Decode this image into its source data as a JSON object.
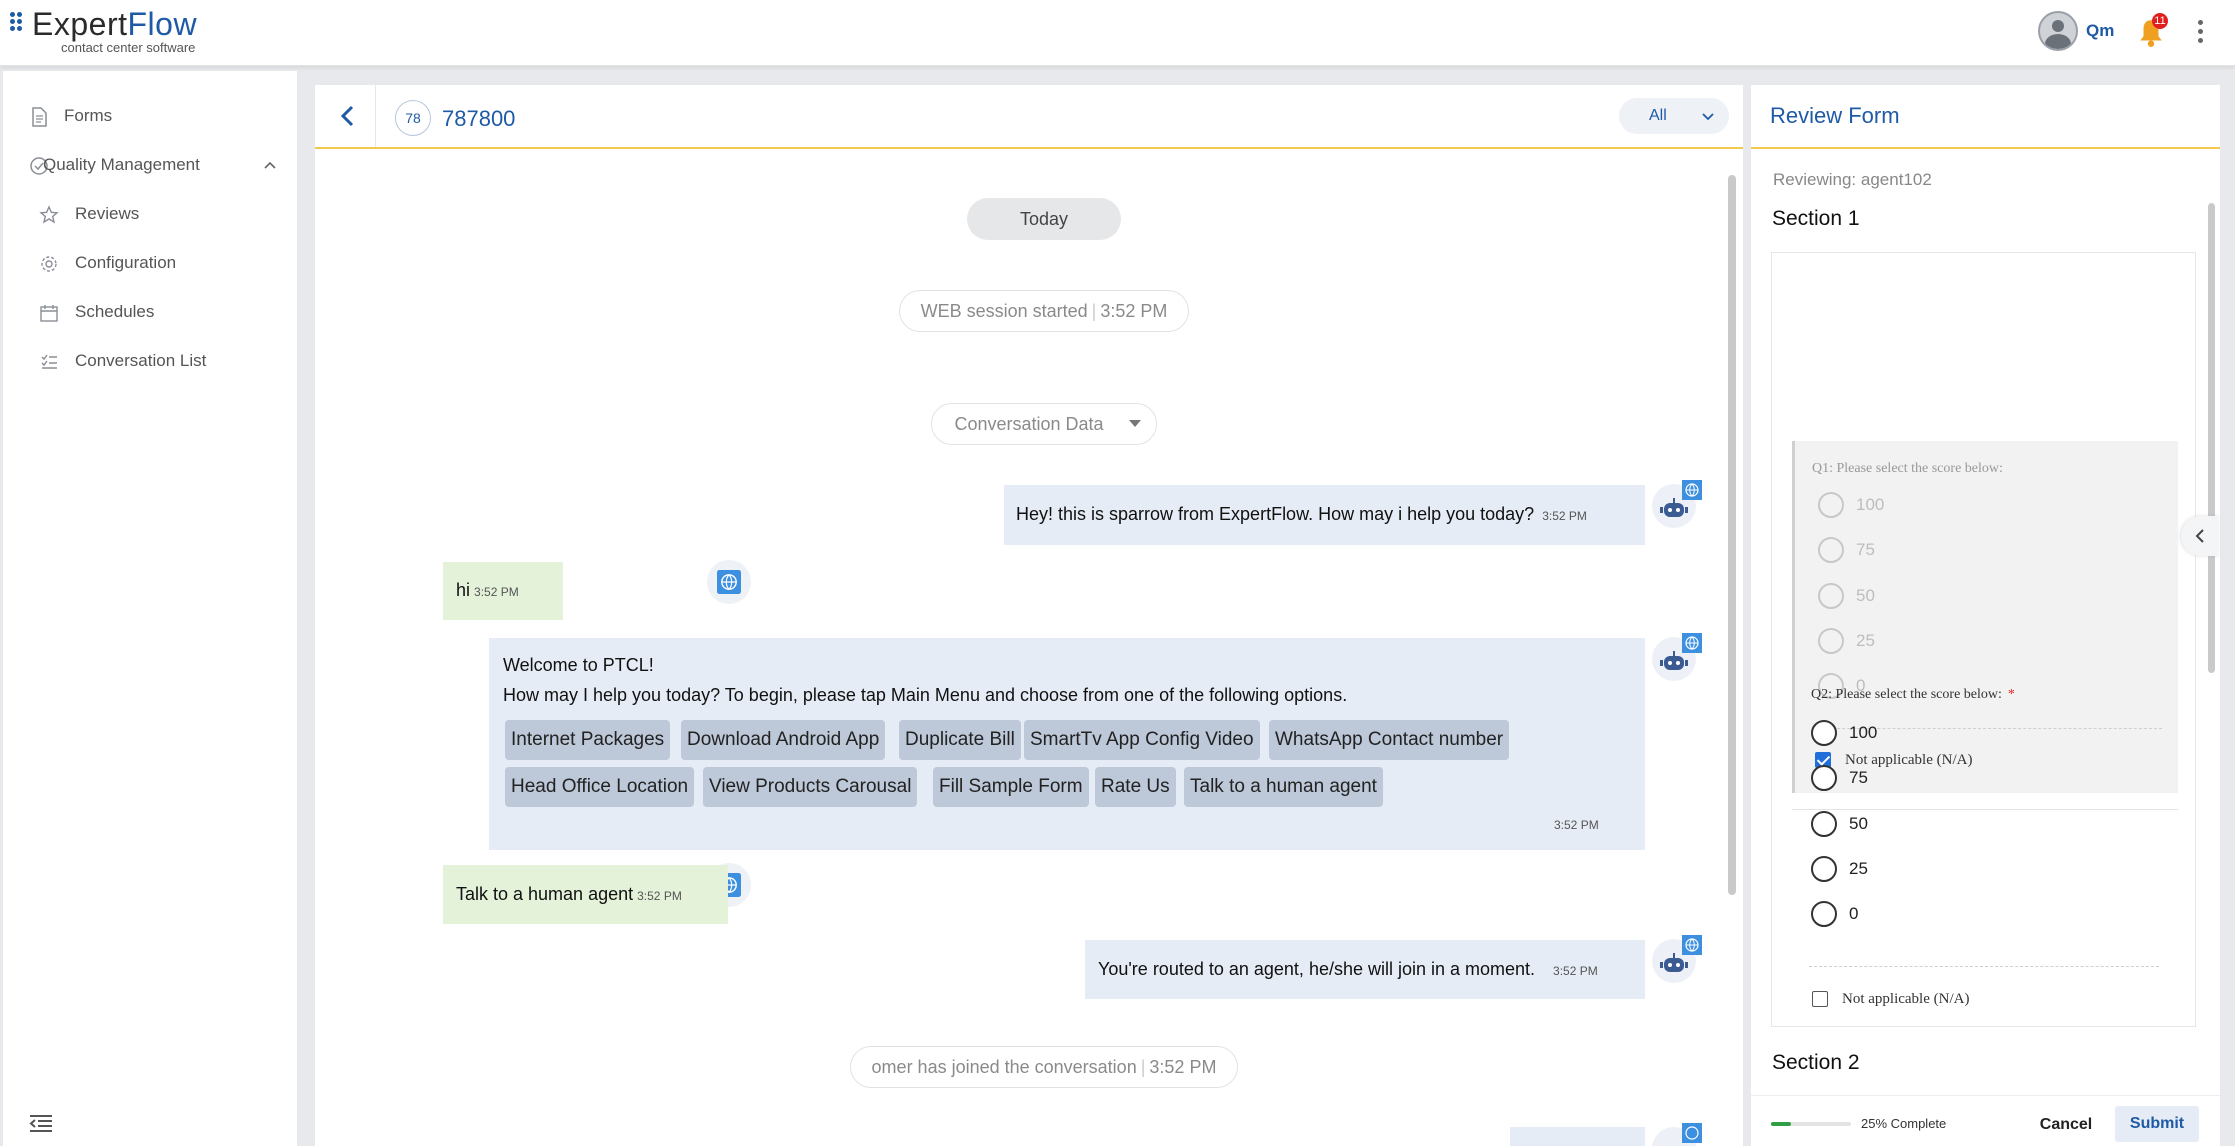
{
  "app": {
    "logo_part1": "Expert",
    "logo_part2": "Flow",
    "tagline": "contact center software",
    "user_name": "Qm",
    "notification_count": "11"
  },
  "sidebar": {
    "items": [
      {
        "label": "Forms",
        "icon": "document-icon"
      },
      {
        "label": "Quality Management",
        "icon": "check-circle-icon"
      },
      {
        "label": "Reviews",
        "icon": "star-icon"
      },
      {
        "label": "Configuration",
        "icon": "gear-icon"
      },
      {
        "label": "Schedules",
        "icon": "calendar-icon"
      },
      {
        "label": "Conversation List",
        "icon": "list-icon"
      }
    ]
  },
  "chat": {
    "badge": "78",
    "conversation_id": "787800",
    "filter": "All",
    "today": "Today",
    "session": {
      "text": "WEB session started",
      "time": "3:52 PM"
    },
    "conversation_data": "Conversation Data",
    "messages": [
      {
        "text": "Hey! this is sparrow from ExpertFlow. How may i help you today?",
        "time": "3:52 PM"
      },
      {
        "text": "hi",
        "time": "3:52 PM"
      },
      {
        "title": "Welcome to PTCL!",
        "text": "How may I help you today? To begin, please tap Main Menu and choose from one of the following options.",
        "time": "3:52 PM"
      },
      {
        "text": "Talk to a human agent",
        "time": "3:52 PM"
      },
      {
        "text": "You're routed to an agent, he/she will join in a moment.",
        "time": "3:52 PM"
      }
    ],
    "quick_replies": [
      "Internet Packages",
      "Download Android App",
      "Duplicate Bill",
      "SmartTv App Config Video",
      "WhatsApp Contact number",
      "Head Office Location",
      "View Products Carousal",
      "Fill Sample Form",
      "Rate Us",
      "Talk to a human agent"
    ],
    "joined": {
      "text": "omer has joined the conversation",
      "time": "3:52 PM"
    }
  },
  "review": {
    "title": "Review Form",
    "reviewing": "Reviewing: agent102",
    "section1": "Section 1",
    "section2": "Section 2",
    "q1": {
      "label": "Q1: Please select the score below:",
      "options": [
        "100",
        "75",
        "50",
        "25",
        "0"
      ],
      "na_label": "Not applicable (N/A)",
      "na_checked": true
    },
    "q2": {
      "label": "Q2: Please select the score below:",
      "required_mark": "*",
      "options": [
        "100",
        "75",
        "50",
        "25",
        "0"
      ],
      "na_label": "Not applicable (N/A)",
      "na_checked": false
    },
    "progress_percent": 25,
    "progress_text": "25% Complete",
    "cancel": "Cancel",
    "submit": "Submit"
  },
  "colors": {
    "brand": "#1f5aa6",
    "accent_line": "#f2c94c",
    "bot_bubble": "#e6ecf5",
    "customer_bubble": "#e4f2d9",
    "quick_reply": "#bdc8d9",
    "progress": "#2ea043"
  }
}
